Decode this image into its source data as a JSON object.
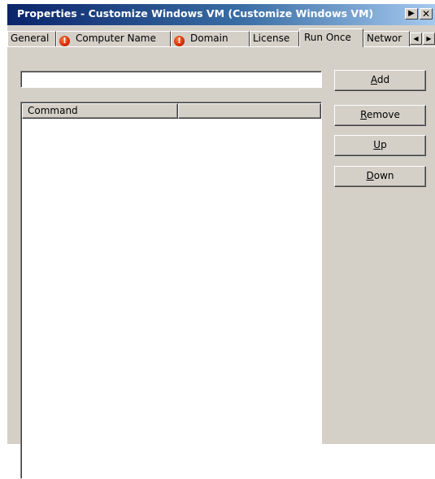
{
  "window": {
    "title": "Properties - Customize Windows VM (Customize Windows VM)",
    "title_buttons": {
      "menu_glyph": "▶",
      "close_glyph": "✕"
    }
  },
  "tabs": [
    {
      "label": "General",
      "warning": false,
      "active": false
    },
    {
      "label": "Computer Name",
      "warning": true,
      "active": false
    },
    {
      "label": "Domain",
      "warning": true,
      "active": false
    },
    {
      "label": "License",
      "warning": false,
      "active": false
    },
    {
      "label": "Run Once",
      "warning": false,
      "active": true
    },
    {
      "label": "Networ",
      "warning": false,
      "active": false
    }
  ],
  "tab_scroll": {
    "left_glyph": "◀",
    "right_glyph": "▶"
  },
  "icons": {
    "warning": "exclamation-circle-icon"
  },
  "warning_glyph": "!",
  "command_input": {
    "value": "",
    "placeholder": ""
  },
  "buttons": {
    "add": {
      "accel": "A",
      "rest": "dd"
    },
    "remove": {
      "accel": "R",
      "rest": "emove"
    },
    "up": {
      "accel": "U",
      "rest": "p"
    },
    "down": {
      "accel": "D",
      "rest": "own"
    }
  },
  "list": {
    "columns": [
      "Command",
      ""
    ],
    "rows": []
  },
  "colors": {
    "title_start": "#0a246a",
    "title_end": "#a6caf0",
    "face": "#d4d0c8",
    "warning": "#d02000"
  }
}
